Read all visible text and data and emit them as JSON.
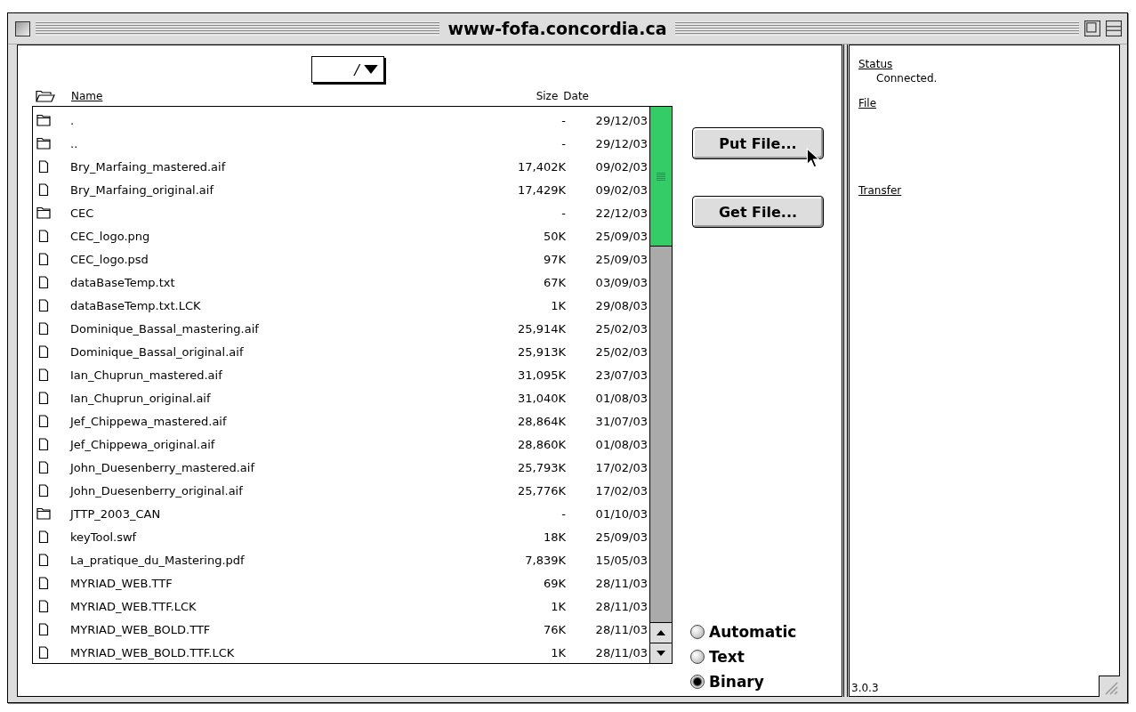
{
  "window": {
    "title": "www-fofa.concordia.ca"
  },
  "path_menu": {
    "value": "/"
  },
  "list_header": {
    "name": "Name",
    "size": "Size",
    "date": "Date"
  },
  "files": [
    {
      "kind": "folder",
      "name": ".",
      "size": "-",
      "date": "29/12/03"
    },
    {
      "kind": "folder",
      "name": "..",
      "size": "-",
      "date": "29/12/03"
    },
    {
      "kind": "file",
      "name": "Bry_Marfaing_mastered.aif",
      "size": "17,402K",
      "date": "09/02/03"
    },
    {
      "kind": "file",
      "name": "Bry_Marfaing_original.aif",
      "size": "17,429K",
      "date": "09/02/03"
    },
    {
      "kind": "folder",
      "name": "CEC",
      "size": "-",
      "date": "22/12/03"
    },
    {
      "kind": "file",
      "name": "CEC_logo.png",
      "size": "50K",
      "date": "25/09/03"
    },
    {
      "kind": "file",
      "name": "CEC_logo.psd",
      "size": "97K",
      "date": "25/09/03"
    },
    {
      "kind": "file",
      "name": "dataBaseTemp.txt",
      "size": "67K",
      "date": "03/09/03"
    },
    {
      "kind": "file",
      "name": "dataBaseTemp.txt.LCK",
      "size": "1K",
      "date": "29/08/03"
    },
    {
      "kind": "file",
      "name": "Dominique_Bassal_mastering.aif",
      "size": "25,914K",
      "date": "25/02/03"
    },
    {
      "kind": "file",
      "name": "Dominique_Bassal_original.aif",
      "size": "25,913K",
      "date": "25/02/03"
    },
    {
      "kind": "file",
      "name": "Ian_Chuprun_mastered.aif",
      "size": "31,095K",
      "date": "23/07/03"
    },
    {
      "kind": "file",
      "name": "Ian_Chuprun_original.aif",
      "size": "31,040K",
      "date": "01/08/03"
    },
    {
      "kind": "file",
      "name": "Jef_Chippewa_mastered.aif",
      "size": "28,864K",
      "date": "31/07/03"
    },
    {
      "kind": "file",
      "name": "Jef_Chippewa_original.aif",
      "size": "28,860K",
      "date": "01/08/03"
    },
    {
      "kind": "file",
      "name": "John_Duesenberry_mastered.aif",
      "size": "25,793K",
      "date": "17/02/03"
    },
    {
      "kind": "file",
      "name": "John_Duesenberry_original.aif",
      "size": "25,776K",
      "date": "17/02/03"
    },
    {
      "kind": "folder",
      "name": "JTTP_2003_CAN",
      "size": "-",
      "date": "01/10/03"
    },
    {
      "kind": "file",
      "name": "keyTool.swf",
      "size": "18K",
      "date": "25/09/03"
    },
    {
      "kind": "file",
      "name": "La_pratique_du_Mastering.pdf",
      "size": "7,839K",
      "date": "15/05/03"
    },
    {
      "kind": "file",
      "name": "MYRIAD_WEB.TTF",
      "size": "69K",
      "date": "28/11/03"
    },
    {
      "kind": "file",
      "name": "MYRIAD_WEB.TTF.LCK",
      "size": "1K",
      "date": "28/11/03"
    },
    {
      "kind": "file",
      "name": "MYRIAD_WEB_BOLD.TTF",
      "size": "76K",
      "date": "28/11/03"
    },
    {
      "kind": "file",
      "name": "MYRIAD_WEB_BOLD.TTF.LCK",
      "size": "1K",
      "date": "28/11/03"
    }
  ],
  "buttons": [
    {
      "label": "Put File..."
    },
    {
      "label": "Get File..."
    }
  ],
  "transfer_modes": [
    {
      "label": "Automatic",
      "selected": false
    },
    {
      "label": "Text",
      "selected": false
    },
    {
      "label": "Binary",
      "selected": true
    }
  ],
  "info_panel": {
    "status_label": "Status",
    "status": "Connected.",
    "file_label": "File",
    "transfer_label": "Transfer",
    "version": "3.0.3"
  }
}
